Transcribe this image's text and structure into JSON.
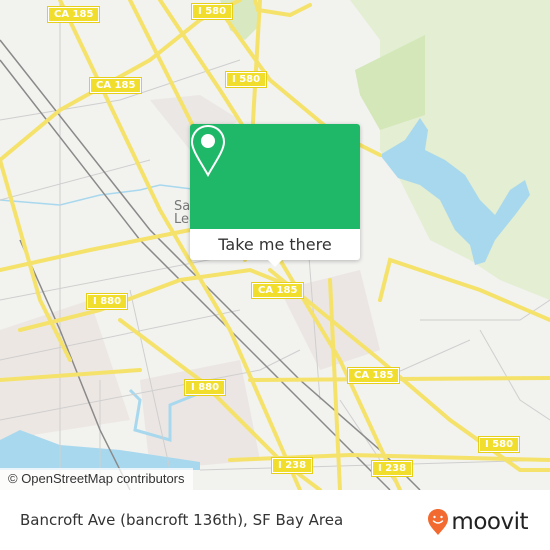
{
  "map": {
    "place_label_line1": "San",
    "place_label_line2": "Leandro",
    "road_shields": [
      "CA 185",
      "CA 185",
      "I 580",
      "I 580",
      "I 880",
      "I 880",
      "CA 185",
      "CA 185",
      "I 238",
      "I 238",
      "I 580"
    ],
    "attribution": "© OpenStreetMap contributors",
    "colors": {
      "land": "#f2f2ef",
      "park": "#dcebc6",
      "water": "#a8d8ee",
      "highway": "#f5e26a",
      "road": "#cfcfcf",
      "rail": "#8a8a8a"
    }
  },
  "popup": {
    "icon": "map-pin-icon",
    "button_label": "Take me there",
    "color": "#1fb868"
  },
  "footer": {
    "title": "Bancroft Ave (bancroft 136th), SF Bay Area",
    "brand": "moovit",
    "brand_color": "#f26a30"
  }
}
